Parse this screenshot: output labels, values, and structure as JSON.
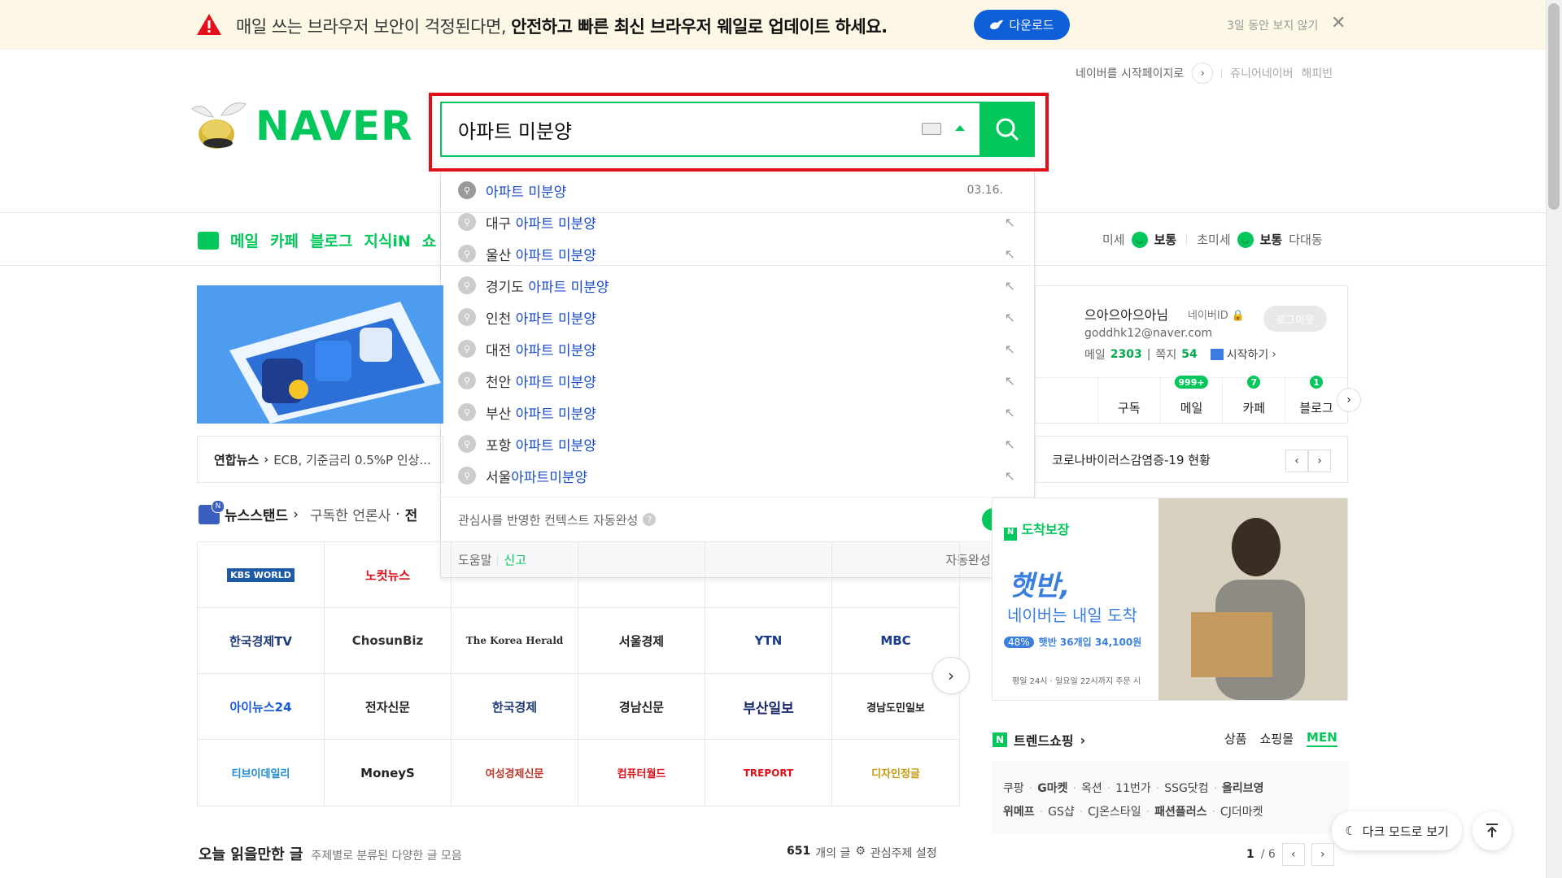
{
  "banner": {
    "text_normal": "매일 쓰는 브라우저 보안이 걱정된다면, ",
    "text_bold": "안전하고 빠른 최신 브라우저 웨일로 업데이트 하세요.",
    "download_label": "다운로드",
    "hide_label": "3일 동안 보지 않기",
    "close_glyph": "✕",
    "accent": "#0e5fd8"
  },
  "toplinks": {
    "startpage": "네이버를 시작페이지로",
    "junior": "쥬니어네이버",
    "happybean": "해피빈"
  },
  "logo": {
    "text": "NAVER",
    "color": "#03c75a"
  },
  "search": {
    "query": "아파트 미분양",
    "suggestions": [
      {
        "prefix": "",
        "hl": "아파트 미분양",
        "date": "03.16.",
        "history": true
      },
      {
        "prefix": "대구 ",
        "hl": "아파트 미분양"
      },
      {
        "prefix": "울산 ",
        "hl": "아파트 미분양"
      },
      {
        "prefix": "경기도 ",
        "hl": "아파트 미분양"
      },
      {
        "prefix": "인천 ",
        "hl": "아파트 미분양"
      },
      {
        "prefix": "대전 ",
        "hl": "아파트 미분양"
      },
      {
        "prefix": "천안 ",
        "hl": "아파트 미분양"
      },
      {
        "prefix": "부산 ",
        "hl": "아파트 미분양"
      },
      {
        "prefix": "포항 ",
        "hl": "아파트 미분양"
      },
      {
        "prefix": "서울",
        "hl": "아파트미분양"
      }
    ],
    "context_label": "관심사를 반영한 컨텍스트 자동완성",
    "context_toggle_on": true,
    "help": "도움말",
    "report": "신고",
    "autocomplete_off": "자동완성 끄기"
  },
  "nav": {
    "items": [
      "메일",
      "카페",
      "블로그",
      "지식iN",
      "쇼"
    ]
  },
  "weather": {
    "fine_dust": "미세",
    "fine_dust_status": "보통",
    "ultrafine": "초미세",
    "ultrafine_status": "보통",
    "location": "다대동"
  },
  "news": {
    "source": "연합뉴스",
    "headline": "ECB, 기준금리 0.5%P 인상..."
  },
  "newsstand": {
    "title": "뉴스스탠드",
    "subscribed": "구독한 언론사",
    "cut": "전",
    "logos": [
      "KBS WORLD",
      "노컷뉴스",
      "",
      "",
      "",
      "",
      "한국경제TV",
      "ChosunBiz",
      "The Korea Herald",
      "서울경제",
      "YTN",
      "MBC",
      "아이뉴스24",
      "전자신문",
      "한국경제",
      "경남신문",
      "부산일보",
      "경남도민일보",
      "티브이데일리",
      "MoneyS",
      "여성경제신문",
      "컴퓨터월드",
      "TREPORT",
      "디자인정글"
    ]
  },
  "read": {
    "title": "오늘 읽을만한 글",
    "subtitle": "주제별로 분류된 다양한 글 모음",
    "count": "651",
    "count_unit": "개의 글",
    "interest": "관심주제 설정"
  },
  "login": {
    "nickname": "으아으아으아님",
    "id_label": "네이버ID",
    "logout": "로그아웃",
    "email": "goddhk12@naver.com",
    "mail_label": "메일",
    "mail_count": "2303",
    "note_label": "쪽지",
    "note_count": "54",
    "start_label": "시작하기",
    "tabs": [
      {
        "label": "",
        "badge": ""
      },
      {
        "label": "구독",
        "badge": ""
      },
      {
        "label": "메일",
        "badge": "999+"
      },
      {
        "label": "카페",
        "badge": "7"
      },
      {
        "label": "블로그",
        "badge": "1"
      }
    ]
  },
  "covid": {
    "text": "코로나바이러스감염증-19 현황"
  },
  "shopad": {
    "brand": "도착보장",
    "headline1": "햇반,",
    "headline2": "네이버는 내일 도착",
    "discount": "48%",
    "product": "햇반 36개입 34,100원",
    "note": "평일 24시 · 일요일 22시까지 주문 시"
  },
  "trend": {
    "title": "트렌드쇼핑",
    "tabs": [
      "상품",
      "쇼핑몰",
      "MEN"
    ]
  },
  "shops": {
    "row1": [
      "쿠팡",
      "G마켓",
      "옥션",
      "11번가",
      "SSG닷컴",
      "올리브영"
    ],
    "row2": [
      "위메프",
      "GS샵",
      "CJ온스타일",
      "패션플러스",
      "CJ더마켓"
    ]
  },
  "page": {
    "current": "1",
    "total": "/ 6"
  },
  "floating": {
    "dark_mode": "다크 모드로 보기"
  }
}
